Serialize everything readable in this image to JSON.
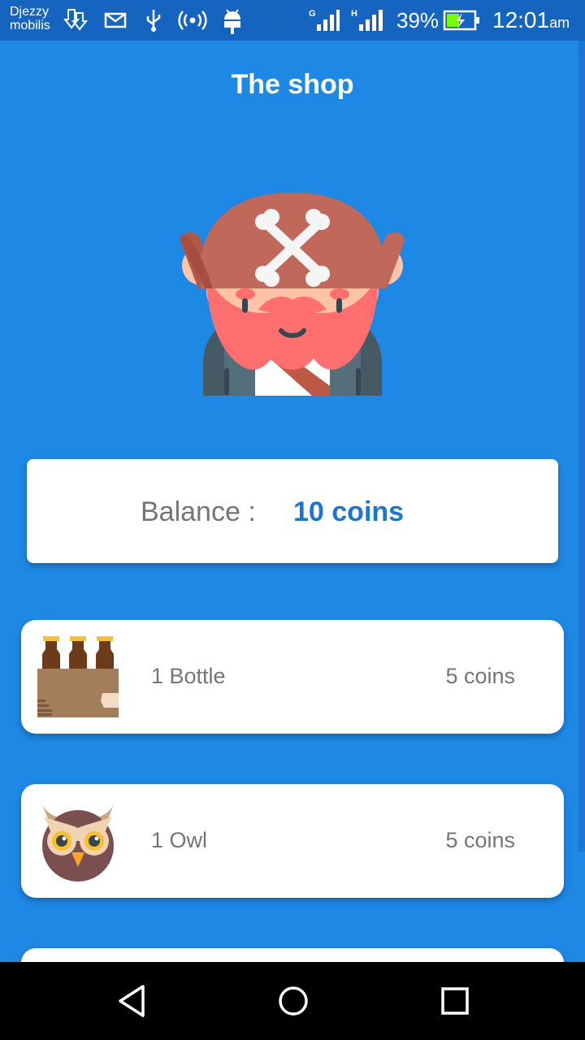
{
  "status_bar": {
    "carrier_line1": "Djezzy",
    "carrier_line2": "mobilis",
    "battery": "39%",
    "time": "12:01",
    "ampm": "am",
    "icons": [
      "download-icon",
      "mail-icon",
      "usb-icon",
      "hotspot-icon",
      "android-icon",
      "signal-g-icon",
      "signal-h-icon",
      "battery-charging-icon"
    ]
  },
  "header": {
    "title": "The shop"
  },
  "avatar": {
    "icon": "pirate-avatar"
  },
  "balance": {
    "label": "Balance :",
    "value": "10 coins"
  },
  "items": [
    {
      "name": "1 Bottle",
      "price": "5 coins",
      "icon": "bottles-crate-icon"
    },
    {
      "name": "1 Owl",
      "price": "5 coins",
      "icon": "owl-icon"
    }
  ],
  "nav": {
    "icons": [
      "back-icon",
      "home-icon",
      "recents-icon"
    ]
  },
  "colors": {
    "background": "#1e88e5",
    "status_bar": "#1565c0",
    "accent": "#1976d2",
    "card": "#ffffff",
    "muted_text": "#757575"
  }
}
